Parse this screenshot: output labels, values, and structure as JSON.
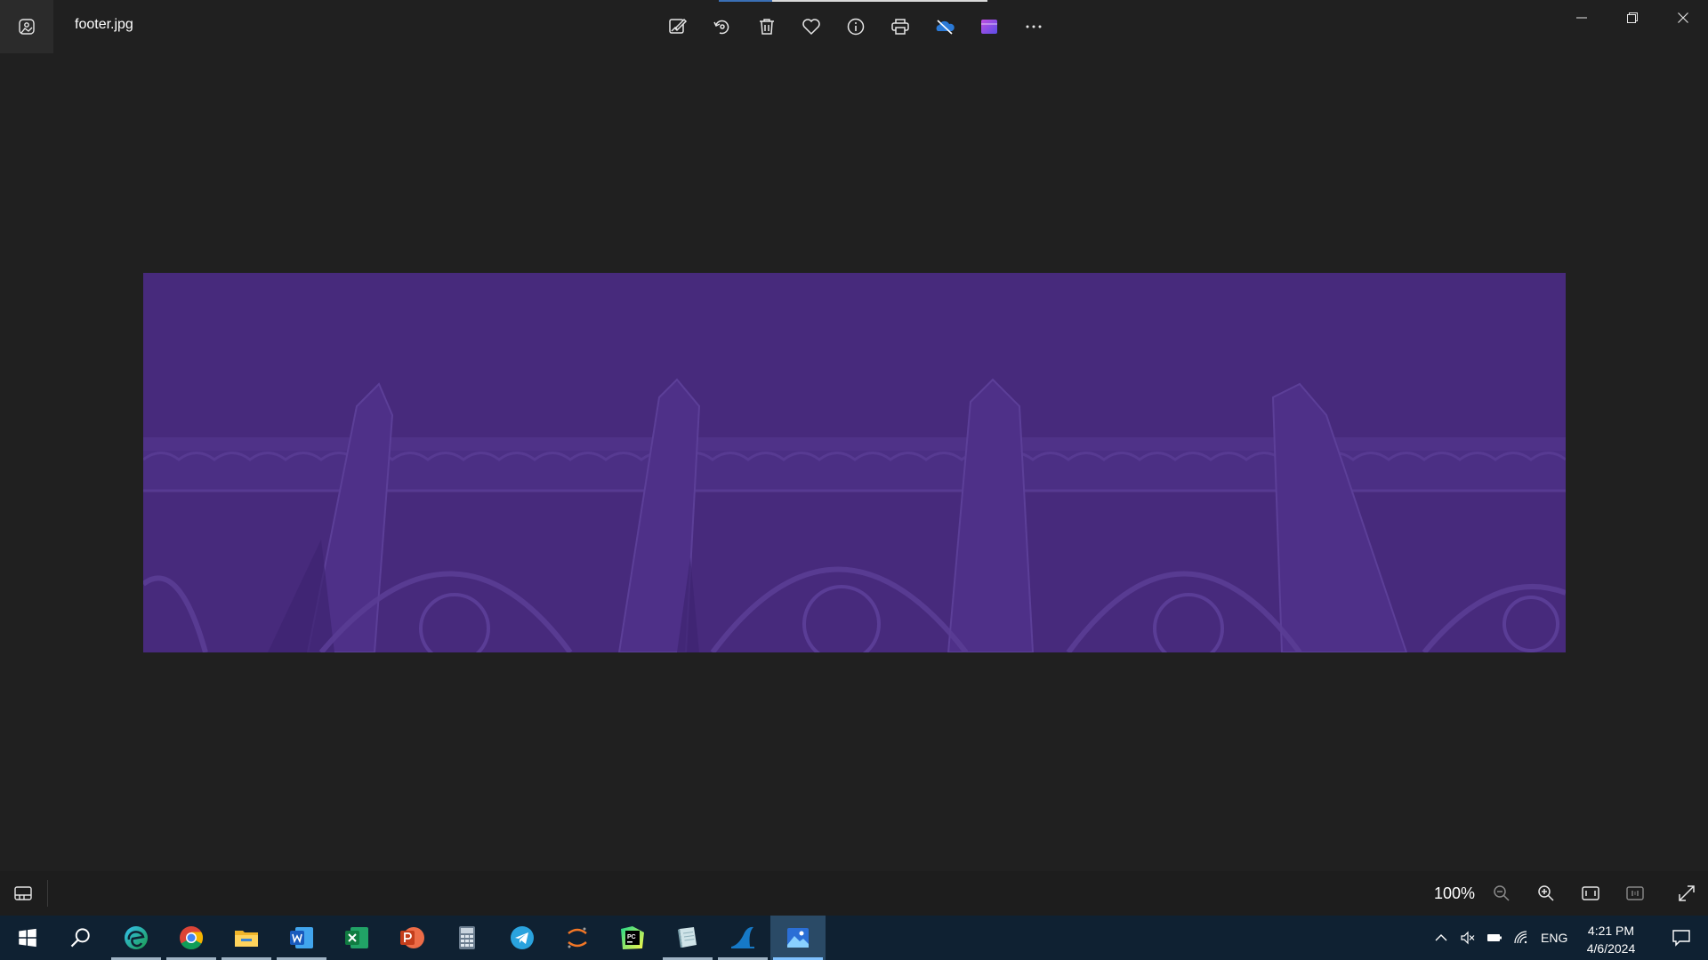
{
  "window": {
    "file_name": "footer.jpg",
    "app_icon": "photos-app-icon"
  },
  "toolbar": {
    "items": [
      {
        "name": "edit-create",
        "icon": "edit-image-icon"
      },
      {
        "name": "rotate",
        "icon": "rotate-icon"
      },
      {
        "name": "delete",
        "icon": "delete-icon"
      },
      {
        "name": "favorite",
        "icon": "heart-icon"
      },
      {
        "name": "file-info",
        "icon": "info-icon"
      },
      {
        "name": "print",
        "icon": "print-icon"
      },
      {
        "name": "onedrive",
        "icon": "onedrive-icon"
      },
      {
        "name": "video-editor",
        "icon": "video-editor-icon"
      },
      {
        "name": "see-more",
        "icon": "more-icon"
      }
    ]
  },
  "window_controls": [
    "minimize",
    "restore",
    "close"
  ],
  "bottom_bar": {
    "zoom_level": "100%",
    "buttons": [
      "zoom-out",
      "zoom-in",
      "fit-to-window",
      "actual-size",
      "full-screen"
    ]
  },
  "taskbar": {
    "apps": [
      {
        "name": "edge",
        "icon": "edge-icon"
      },
      {
        "name": "chrome",
        "icon": "chrome-icon"
      },
      {
        "name": "file-explorer",
        "icon": "folder-icon"
      },
      {
        "name": "word",
        "icon": "word-icon"
      },
      {
        "name": "excel",
        "icon": "excel-icon"
      },
      {
        "name": "powerpoint",
        "icon": "powerpoint-icon"
      },
      {
        "name": "calculator",
        "icon": "calculator-icon"
      },
      {
        "name": "telegram",
        "icon": "telegram-icon"
      },
      {
        "name": "jupyter",
        "icon": "jupyter-icon"
      },
      {
        "name": "pycharm",
        "icon": "pycharm-icon"
      },
      {
        "name": "notes-app",
        "icon": "notes-icon"
      },
      {
        "name": "wireshark",
        "icon": "wireshark-icon"
      },
      {
        "name": "photos",
        "icon": "photos-icon",
        "active": true
      }
    ],
    "language": "ENG",
    "time": "4:21 PM",
    "date": "4/6/2024"
  },
  "colors": {
    "background": "#202020",
    "photo_tint": "#472a7c",
    "taskbar": "#0f2132",
    "accent": "#7fc1ff"
  }
}
